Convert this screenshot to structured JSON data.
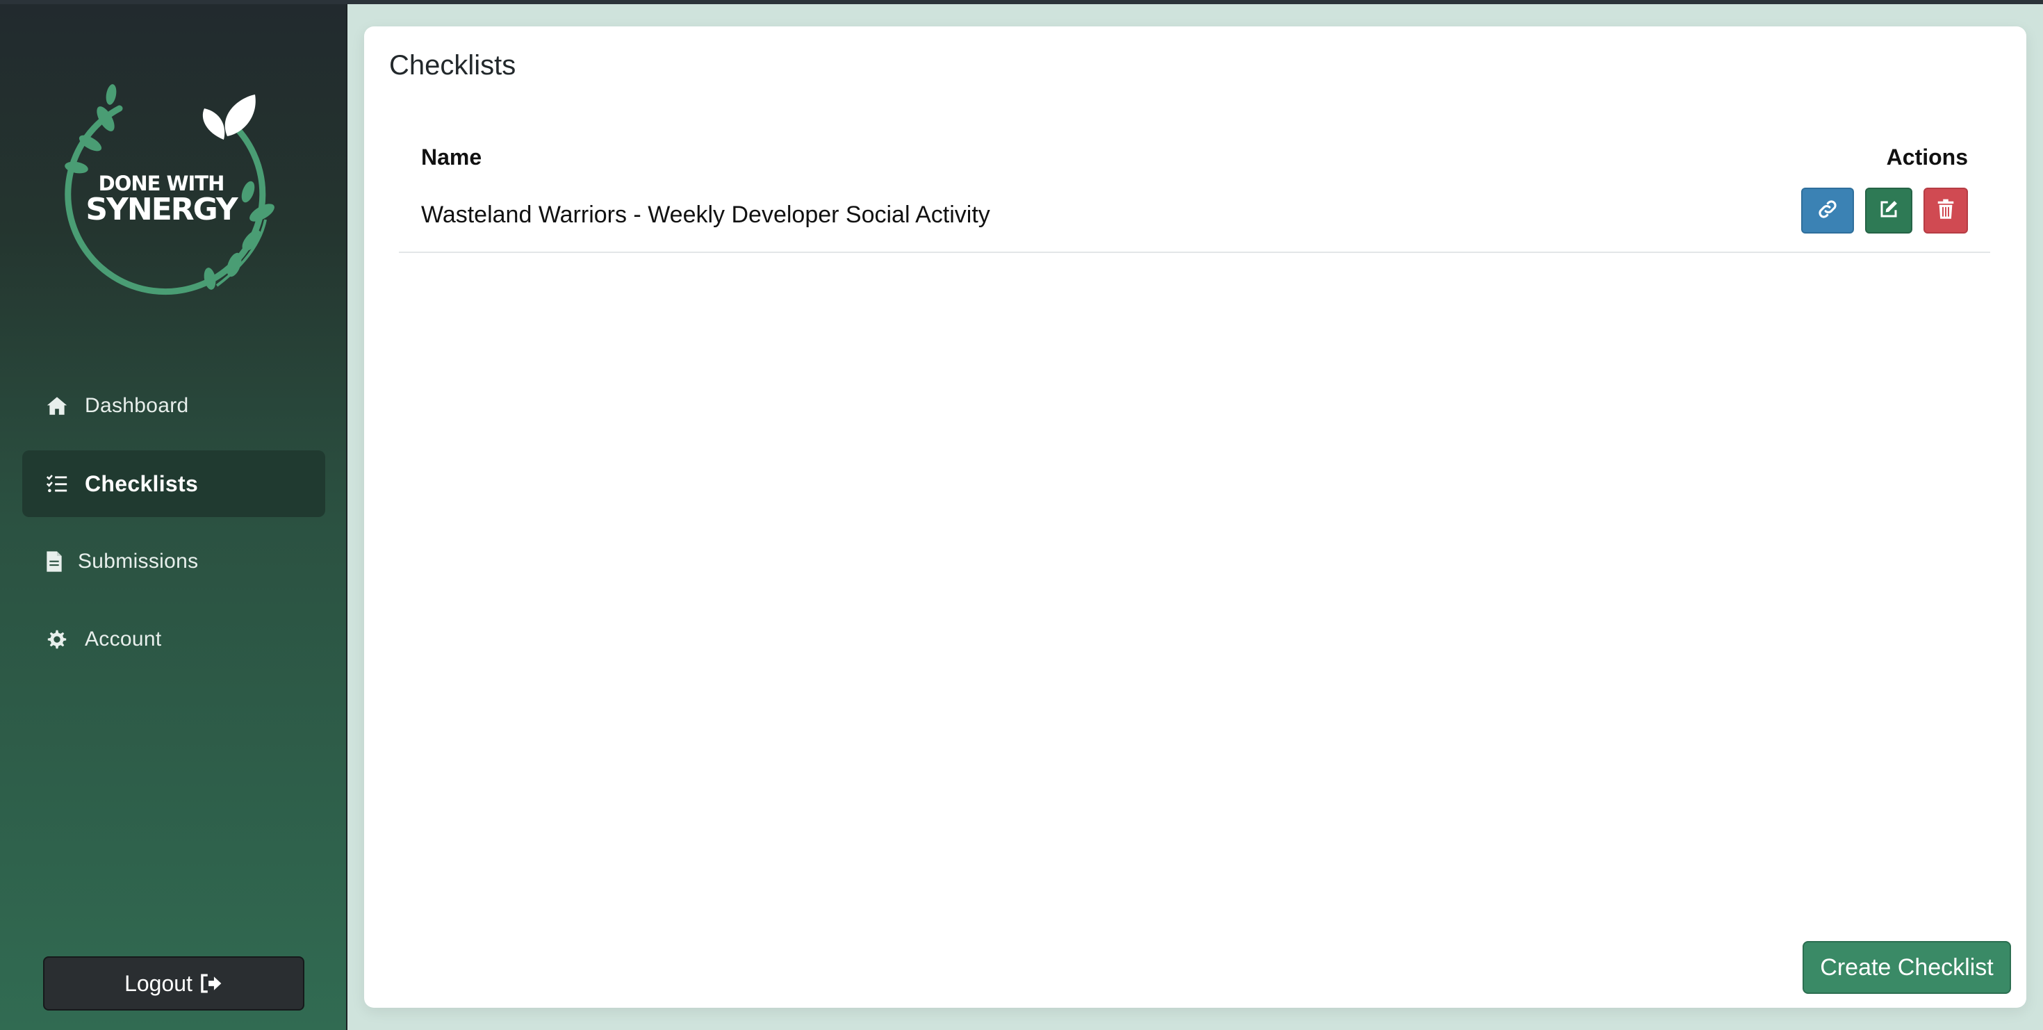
{
  "colors": {
    "sidebar_top": "#222a2e",
    "sidebar_bottom": "#316b52",
    "page_bg": "#cfe3dc",
    "link_button": "#3b82b4",
    "edit_button": "#2e7a55",
    "delete_button": "#d04a52",
    "create_button": "#3a8a66"
  },
  "logo": {
    "line1": "DONE WITH",
    "line2": "SYNERGY"
  },
  "sidebar": {
    "items": [
      {
        "label": "Dashboard",
        "icon": "home-icon",
        "active": false
      },
      {
        "label": "Checklists",
        "icon": "list-check-icon",
        "active": true
      },
      {
        "label": "Submissions",
        "icon": "file-icon",
        "active": false
      },
      {
        "label": "Account",
        "icon": "gear-icon",
        "active": false
      }
    ],
    "logout_label": "Logout",
    "logout_icon": "sign-out-icon"
  },
  "main": {
    "title": "Checklists",
    "table": {
      "headers": {
        "name": "Name",
        "actions": "Actions"
      },
      "rows": [
        {
          "name": "Wasteland Warriors - Weekly Developer Social Activity",
          "actions": [
            "link-icon",
            "edit-icon",
            "trash-icon"
          ]
        }
      ]
    },
    "create_label": "Create Checklist"
  }
}
